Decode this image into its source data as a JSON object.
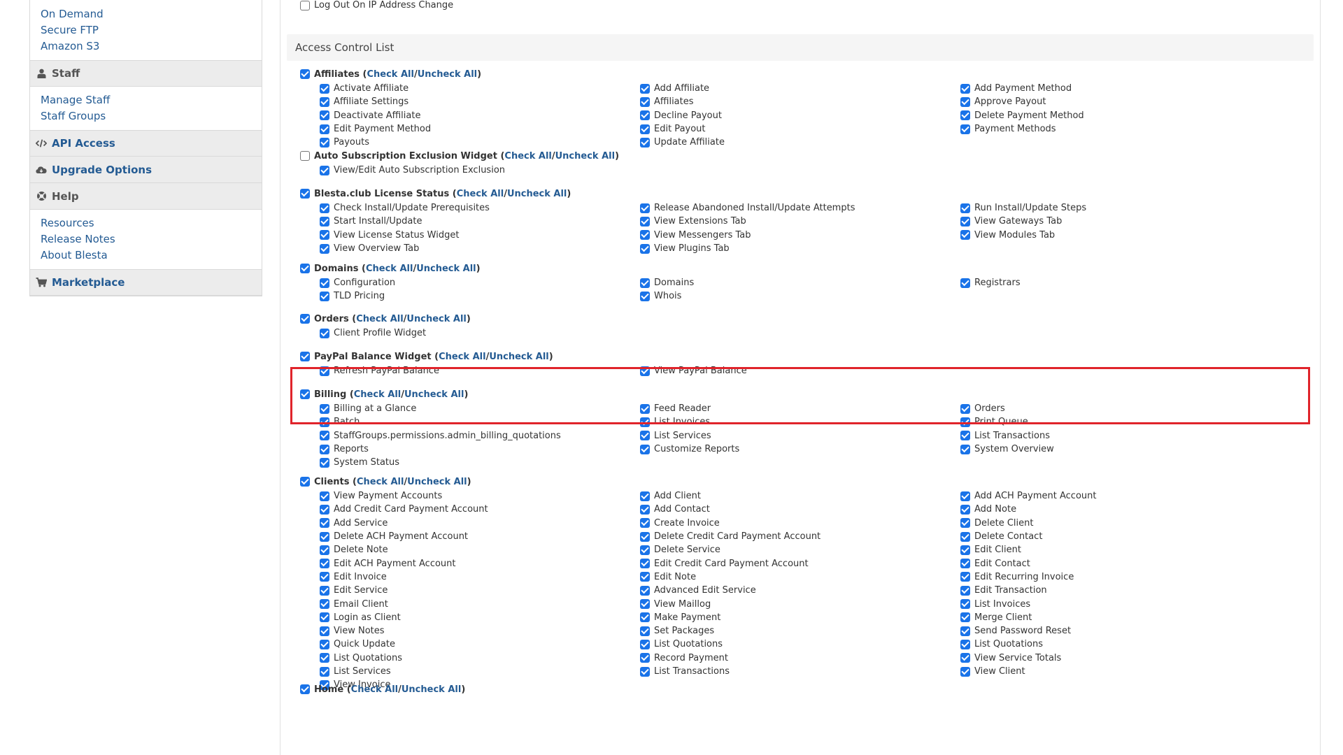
{
  "sidebar": {
    "top_links": [
      "On Demand",
      "Secure FTP",
      "Amazon S3"
    ],
    "staff": {
      "title": "Staff",
      "icon": "user-icon",
      "links": [
        "Manage Staff",
        "Staff Groups"
      ]
    },
    "api": {
      "title": "API Access",
      "icon": "code-icon"
    },
    "upgrade": {
      "title": "Upgrade Options",
      "icon": "cloud-download-icon"
    },
    "help": {
      "title": "Help",
      "icon": "life-ring-icon",
      "links": [
        "Resources",
        "Release Notes",
        "About Blesta"
      ]
    },
    "marketplace": {
      "title": "Marketplace",
      "icon": "cart-icon"
    }
  },
  "main": {
    "logout_label": "Log Out On IP Address Change",
    "acl_title": "Access Control List",
    "check_all": "Check All",
    "uncheck_all": "Uncheck All",
    "groups": [
      {
        "title": "Affiliates",
        "checked": true,
        "items": [
          "Activate Affiliate",
          "Add Affiliate",
          "Add Payment Method",
          "Affiliate Settings",
          "Affiliates",
          "Approve Payout",
          "Deactivate Affiliate",
          "Decline Payout",
          "Delete Payment Method",
          "Edit Payment Method",
          "Edit Payout",
          "Payment Methods",
          "Payouts",
          "Update Affiliate"
        ]
      },
      {
        "title": "Auto Subscription Exclusion Widget",
        "checked": false,
        "items": [
          "View/Edit Auto Subscription Exclusion"
        ]
      },
      {
        "title": "Blesta.club License Status",
        "checked": true,
        "items": [
          "Check Install/Update Prerequisites",
          "Release Abandoned Install/Update Attempts",
          "Run Install/Update Steps",
          "Start Install/Update",
          "View Extensions Tab",
          "View Gateways Tab",
          "View License Status Widget",
          "View Messengers Tab",
          "View Modules Tab",
          "View Overview Tab",
          "View Plugins Tab"
        ]
      },
      {
        "title": "Domains",
        "checked": true,
        "items": [
          "Configuration",
          "Domains",
          "Registrars",
          "TLD Pricing",
          "Whois"
        ]
      },
      {
        "title": "Orders",
        "checked": true,
        "items": [
          "Client Profile Widget"
        ]
      },
      {
        "title": "PayPal Balance Widget",
        "checked": true,
        "items": [
          "Refresh PayPal Balance",
          "View PayPal Balance"
        ]
      },
      {
        "title": "Billing",
        "checked": true,
        "items": [
          "Billing at a Glance",
          "Feed Reader",
          "Orders",
          "Batch",
          "List Invoices",
          "Print Queue",
          "StaffGroups.permissions.admin_billing_quotations",
          "List Services",
          "List Transactions",
          "Reports",
          "Customize Reports",
          "System Overview",
          "System Status"
        ]
      },
      {
        "title": "Clients",
        "checked": true,
        "items": [
          "View Payment Accounts",
          "Add Client",
          "Add ACH Payment Account",
          "Add Credit Card Payment Account",
          "Add Contact",
          "Add Note",
          "Add Service",
          "Create Invoice",
          "Delete Client",
          "Delete ACH Payment Account",
          "Delete Credit Card Payment Account",
          "Delete Contact",
          "Delete Note",
          "Delete Service",
          "Edit Client",
          "Edit ACH Payment Account",
          "Edit Credit Card Payment Account",
          "Edit Contact",
          "Edit Invoice",
          "Edit Note",
          "Edit Recurring Invoice",
          "Edit Service",
          "Advanced Edit Service",
          "Edit Transaction",
          "Email Client",
          "View Maillog",
          "List Invoices",
          "Login as Client",
          "Make Payment",
          "Merge Client",
          "View Notes",
          "Set Packages",
          "Send Password Reset",
          "Quick Update",
          "List Quotations",
          "List Quotations",
          "List Quotations",
          "Record Payment",
          "View Service Totals",
          "List Services",
          "List Transactions",
          "View Client",
          "View Invoice"
        ]
      },
      {
        "title": "Home",
        "checked": true,
        "items": []
      }
    ]
  }
}
